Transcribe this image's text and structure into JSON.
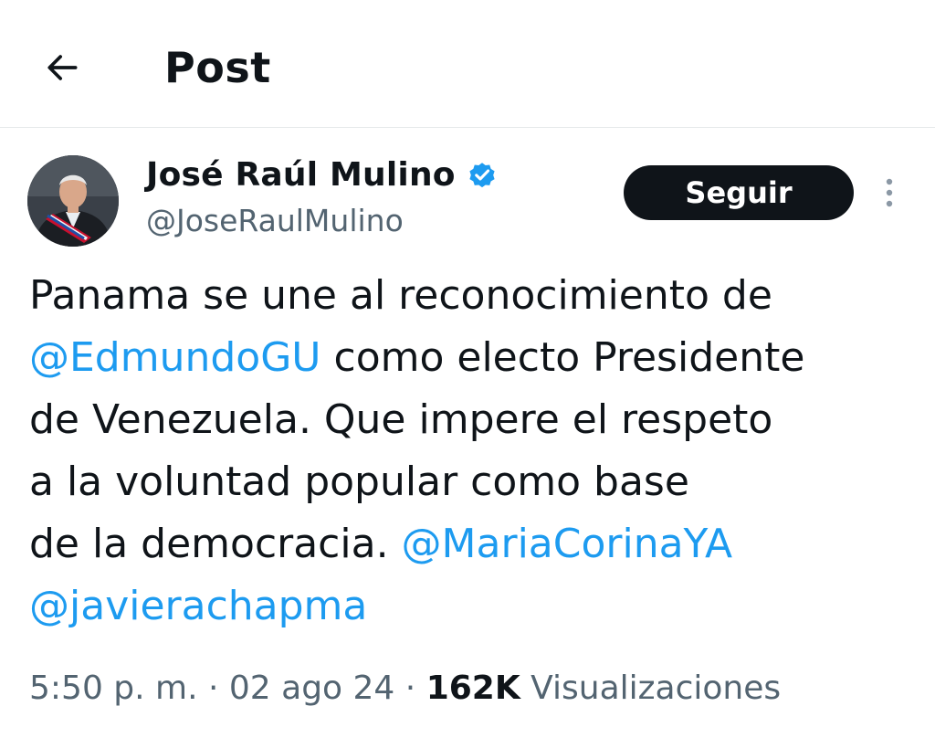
{
  "header": {
    "title": "Post"
  },
  "author": {
    "display_name": "José Raúl Mulino",
    "handle": "@JoseRaulMulino",
    "verified": true
  },
  "actions": {
    "follow_label": "Seguir"
  },
  "tweet": {
    "line1": "Panama se une al reconocimiento de",
    "mention1": "@EdmundoGU",
    "line2_rest": " como electo Presidente",
    "line3": "de Venezuela. Que impere el respeto",
    "line4": "a la voluntad popular como base",
    "line5_text": "de la democracia. ",
    "mention2": "@MariaCorinaYA",
    "mention3": "@javierachapma"
  },
  "meta": {
    "time": "5:50 p. m.",
    "sep1": " · ",
    "date": "02 ago 24",
    "sep2": " · ",
    "views_count": "162K",
    "views_label": " Visualizaciones"
  },
  "colors": {
    "accent": "#1d9bf0",
    "text": "#0f1419",
    "secondary": "#536471",
    "button_bg": "#0f1419"
  }
}
